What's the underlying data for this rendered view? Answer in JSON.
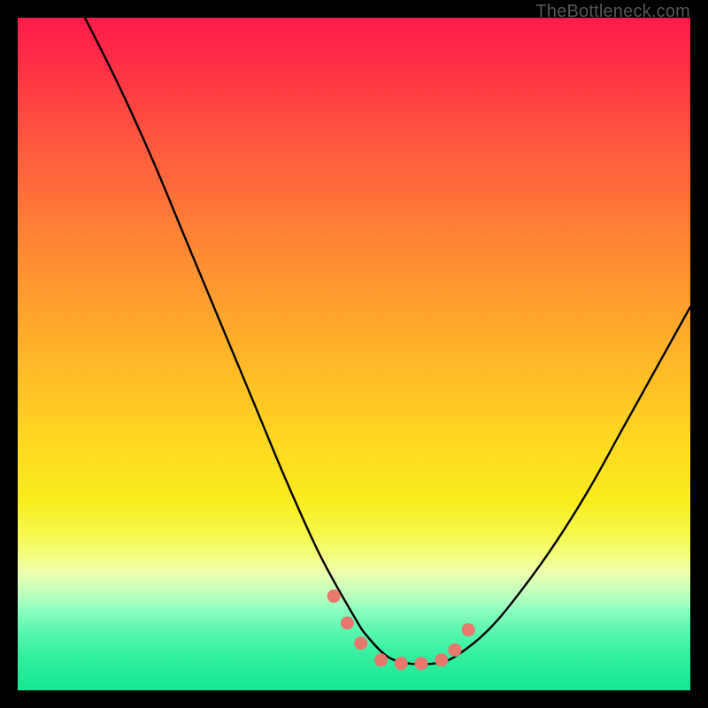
{
  "watermark": "TheBottleneck.com",
  "colors": {
    "frame": "#000000",
    "curve": "#000000",
    "marker": "#e8776d",
    "gradient_top": "#ff1a4d",
    "gradient_bottom": "#14e892"
  },
  "chart_data": {
    "type": "line",
    "title": "",
    "xlabel": "",
    "ylabel": "",
    "xlim": [
      0,
      100
    ],
    "ylim": [
      0,
      100
    ],
    "grid": false,
    "legend": false,
    "annotations": [],
    "series": [
      {
        "name": "bottleneck-curve",
        "x": [
          10,
          15,
          20,
          25,
          30,
          35,
          40,
          45,
          50,
          52,
          55,
          58,
          60,
          62,
          65,
          70,
          75,
          80,
          85,
          90,
          95,
          100
        ],
        "values": [
          100,
          90,
          79,
          67,
          55,
          43,
          31,
          20,
          11,
          8,
          5,
          4,
          4,
          4,
          5,
          9,
          15,
          22,
          30,
          39,
          48,
          57
        ]
      }
    ],
    "markers": {
      "name": "highlight-points",
      "x": [
        47,
        49,
        51,
        54,
        57,
        60,
        63,
        65,
        67
      ],
      "values": [
        14,
        10,
        7,
        4.5,
        4,
        4,
        4.5,
        6,
        9
      ]
    }
  }
}
